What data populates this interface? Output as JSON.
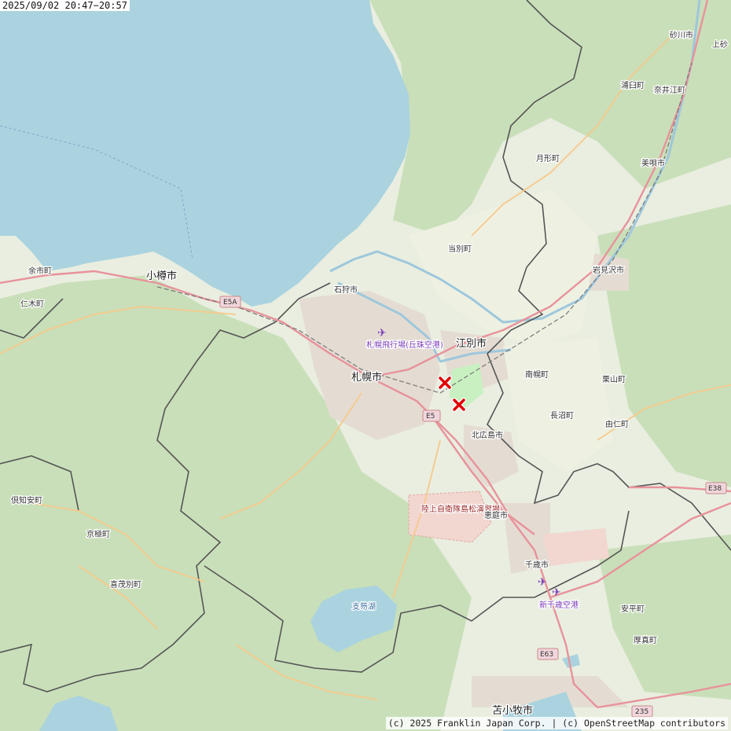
{
  "timestamp": "2025/09/02 20:47−20:57",
  "attribution": "(c) 2025 Franklin Japan Corp. | (c) OpenStreetMap contributors",
  "colors": {
    "sea": "#aad3df",
    "land": "#e9eee0",
    "forest": "#c9dfb9",
    "urban": "#e4dcd2",
    "border": "#555555",
    "road_major": "#e8929b",
    "road_minor": "#f7c98b",
    "marker": "#e00000"
  },
  "places": {
    "sunagawa": "砂川市",
    "kamisuna": "上砂",
    "urausu": "浦臼町",
    "naie": "奈井江町",
    "tsukigata": "月形町",
    "bibai": "美唄市",
    "tobetsu": "当別町",
    "iwamizawa": "岩見沢市",
    "yoichi": "余市町",
    "otaru": "小樽市",
    "niki": "仁木町",
    "ishikari": "石狩市",
    "okadama_airport": "札幌飛行場(丘珠空港)",
    "ebetsu": "江別市",
    "nanporo": "南幌町",
    "sapporo": "札幌市",
    "kuriyama": "栗山町",
    "naganuma": "長沼町",
    "yuni": "由仁町",
    "kitahiroshima": "北広島市",
    "kutchan": "倶知安町",
    "jsdf": "陸上自衛隊島松演習場",
    "eniwa": "恵庭市",
    "kyogoku": "京極町",
    "chitose": "千歳市",
    "kimobetsu": "喜茂別町",
    "shikotsu": "支笏湖",
    "new_chitose": "新千歳空港",
    "abira": "安平町",
    "atsuma": "厚真町",
    "tomakomai": "苫小牧市"
  },
  "routes": [
    "E5A",
    "E5",
    "E38",
    "E63",
    "235"
  ],
  "markers": [
    {
      "label": "marker-1",
      "symbol": "x"
    },
    {
      "label": "marker-2",
      "symbol": "x"
    }
  ]
}
